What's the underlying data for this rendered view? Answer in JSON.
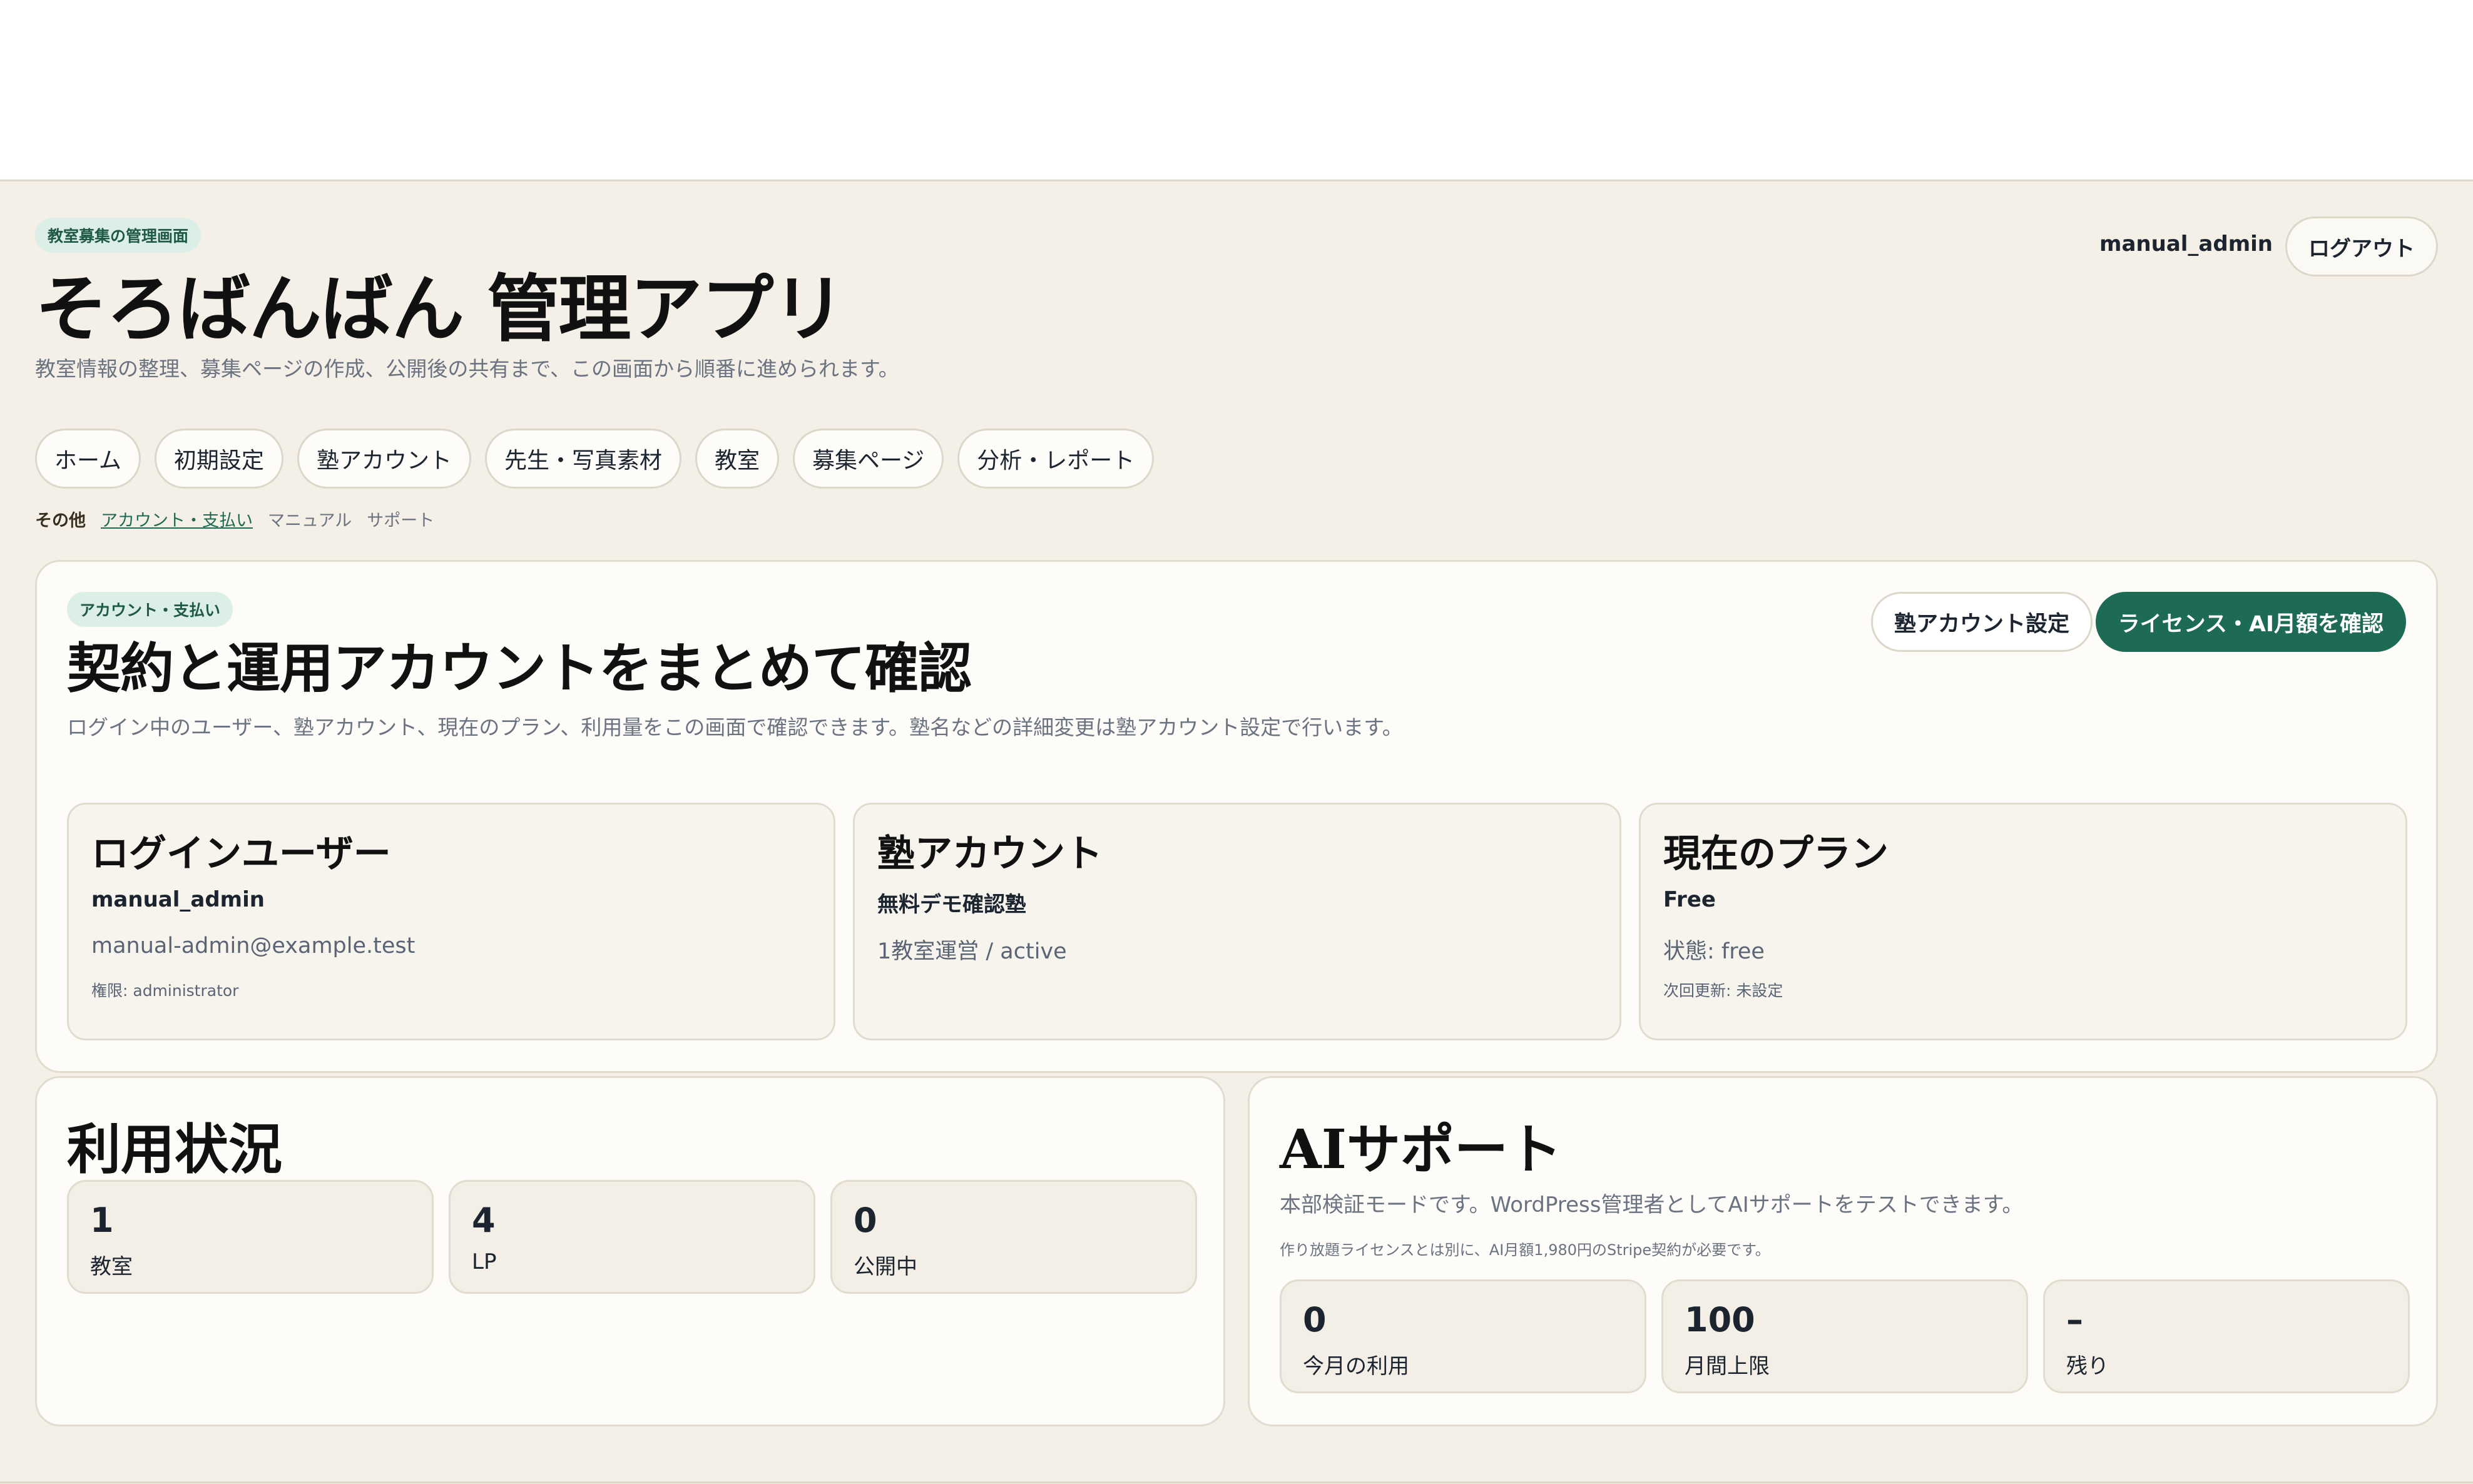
{
  "header": {
    "eyebrow": "教室募集の管理画面",
    "title": "そろばんばん 管理アプリ",
    "subtitle": "教室情報の整理、募集ページの作成、公開後の共有まで、この画面から順番に進められます。",
    "user": "manual_admin",
    "logout_label": "ログアウト"
  },
  "nav": {
    "items": [
      "ホーム",
      "初期設定",
      "塾アカウント",
      "先生・写真素材",
      "教室",
      "募集ページ",
      "分析・レポート"
    ]
  },
  "subnav": {
    "label": "その他",
    "active": "アカウント・支払い",
    "links": [
      "マニュアル",
      "サポート"
    ]
  },
  "hero": {
    "eyebrow": "アカウント・支払い",
    "title": "契約と運用アカウントをまとめて確認",
    "subtitle": "ログイン中のユーザー、塾アカウント、現在のプラン、利用量をこの画面で確認できます。塾名などの詳細変更は塾アカウント設定で行います。",
    "btn_settings": "塾アカウント設定",
    "btn_license": "ライセンス・AI月額を確認",
    "cards": [
      {
        "title": "ログインユーザー",
        "strong": "manual_admin",
        "mid": "manual-admin@example.test",
        "small": "権限: administrator"
      },
      {
        "title": "塾アカウント",
        "strong": "無料デモ確認塾",
        "mid": "1教室運営 / active",
        "small": ""
      },
      {
        "title": "現在のプラン",
        "strong": "Free",
        "mid": "状態: free",
        "small": "次回更新: 未設定"
      }
    ]
  },
  "usage": {
    "title": "利用状況",
    "stats": [
      {
        "value": "1",
        "label": "教室"
      },
      {
        "value": "4",
        "label": "LP"
      },
      {
        "value": "0",
        "label": "公開中"
      }
    ]
  },
  "ai": {
    "title": "AIサポート",
    "subtitle": "本部検証モードです。WordPress管理者としてAIサポートをテストできます。",
    "note": "作り放題ライセンスとは別に、AI月額1,980円のStripe契約が必要です。",
    "stats": [
      {
        "value": "0",
        "label": "今月の利用"
      },
      {
        "value": "100",
        "label": "月間上限"
      },
      {
        "value": "–",
        "label": "残り"
      }
    ]
  },
  "colors": {
    "background": "#f4f0e8",
    "accent": "#1d6a55",
    "eyebrow_bg": "#dcefe7"
  }
}
